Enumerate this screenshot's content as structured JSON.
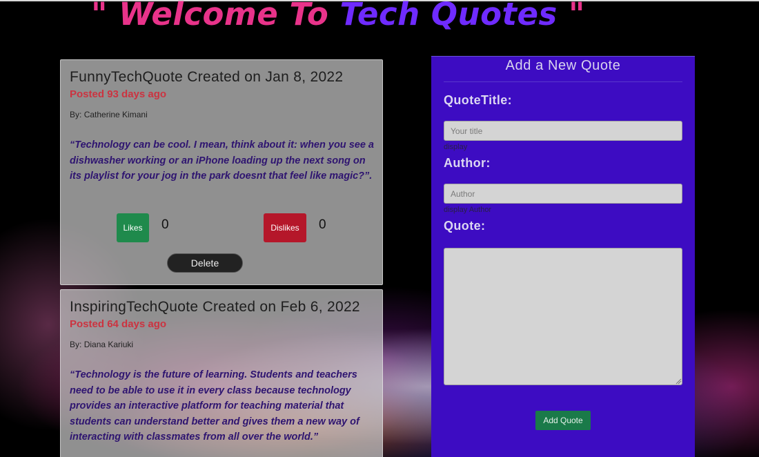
{
  "header": {
    "open_quote": "\"",
    "welcome": "Welcome To",
    "brand": "Tech Quotes",
    "close_quote": "\""
  },
  "quotes": [
    {
      "name": "FunnyTechQuote",
      "created_label": "Created on",
      "date": "Jan 8, 2022",
      "posted_prefix": "Posted",
      "posted_age": "93 days ago",
      "author_prefix": "By:",
      "author": "Catherine Kimani",
      "text": "“Technology can be cool. I mean, think about it: when you see a dishwasher working or an iPhone loading up the next song on its playlist for your jog in the park doesnt that feel like magic?”.",
      "likes_label": "Likes",
      "likes": "0",
      "dislikes_label": "Dislikes",
      "dislikes": "0",
      "delete_label": "Delete"
    },
    {
      "name": "InspiringTechQuote",
      "created_label": "Created on",
      "date": "Feb 6, 2022",
      "posted_prefix": "Posted",
      "posted_age": "64 days ago",
      "author_prefix": "By:",
      "author": "Diana Kariuki",
      "text": "“Technology is the future of learning. Students and teachers need to be able to use it in every class because technology provides an interactive platform for teaching material that students can understand better and gives them a new way of interacting with classmates from all over the world.”"
    }
  ],
  "form": {
    "title": "Add a New Quote",
    "title_label": "QuoteTitle:",
    "title_placeholder": "Your title",
    "title_hint": "display",
    "author_label": "Author:",
    "author_placeholder": "Author",
    "author_hint": "display Author",
    "quote_label": "Quote:",
    "quote_value": "",
    "submit_label": "Add Quote"
  },
  "colors": {
    "welcome_pink": "#e8338a",
    "brand_purple": "#6f2bff",
    "panel_purple": "#3d0cc2",
    "likes_green": "#1f8a4c",
    "dislikes_red": "#b5172a",
    "posted_red": "#cc3340"
  }
}
